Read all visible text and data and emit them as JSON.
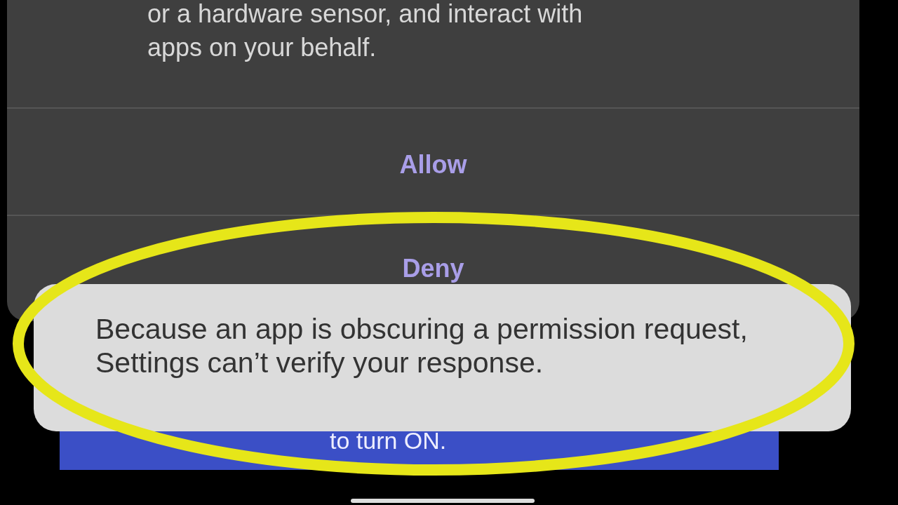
{
  "dialog": {
    "message_lines": [
      "or a hardware sensor, and interact with",
      "apps on your behalf."
    ],
    "buttons": [
      "Allow",
      "Deny"
    ]
  },
  "banner": {
    "text": "to turn ON."
  },
  "toast": {
    "text": "Because an app is obscuring a permission request, Settings can’t verify your response."
  }
}
